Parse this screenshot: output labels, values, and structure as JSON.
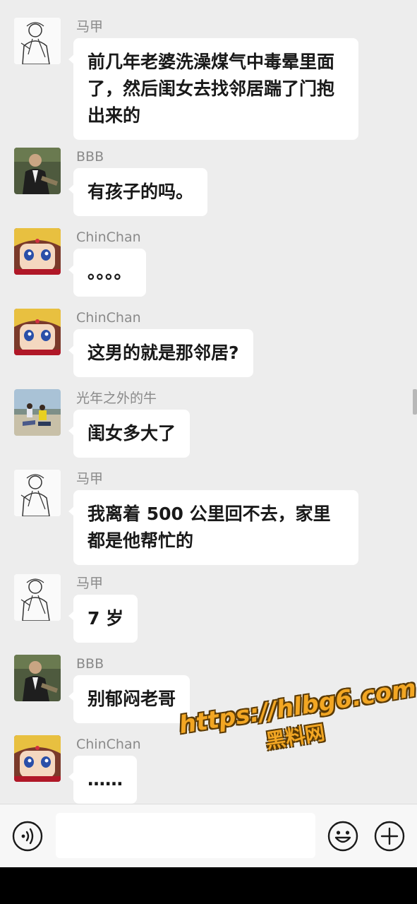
{
  "messages": [
    {
      "sender": "马甲",
      "avatar": "sketch-man-avatar",
      "text": "前几年老婆洗澡煤气中毒晕里面了，然后闺女去找邻居踹了门抱出来的"
    },
    {
      "sender": "BBB",
      "avatar": "man-in-suit-avatar",
      "text": "有孩子的吗。"
    },
    {
      "sender": "ChinChan",
      "avatar": "anime-girl-avatar",
      "text": "。。。。"
    },
    {
      "sender": "ChinChan",
      "avatar": "anime-girl-avatar",
      "text": "这男的就是那邻居?"
    },
    {
      "sender": "光年之外的牛",
      "avatar": "family-photo-avatar",
      "text": "闺女多大了"
    },
    {
      "sender": "马甲",
      "avatar": "sketch-man-avatar",
      "text": "我离着 500 公里回不去，家里都是他帮忙的"
    },
    {
      "sender": "马甲",
      "avatar": "sketch-man-avatar",
      "text": "7 岁"
    },
    {
      "sender": "BBB",
      "avatar": "man-in-suit-avatar",
      "text": "别郁闷老哥"
    },
    {
      "sender": "ChinChan",
      "avatar": "anime-girl-avatar",
      "text": "……"
    }
  ],
  "watermark": {
    "line1": "https://hlbg6.com",
    "line2": "黑料网"
  },
  "input_bar": {
    "voice_icon": "voice-icon",
    "input_value": "",
    "emoji_icon": "emoji-icon",
    "plus_icon": "plus-icon"
  },
  "colors": {
    "background": "#ededed",
    "bubble": "#ffffff",
    "watermark": "#f2a623"
  }
}
